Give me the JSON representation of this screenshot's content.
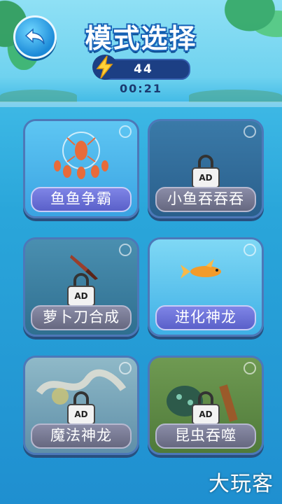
{
  "header": {
    "title": "模式选择",
    "energy_value": "44",
    "timer": "00:21"
  },
  "modes": [
    {
      "label": "鱼鱼争霸",
      "locked": false,
      "lock_text": ""
    },
    {
      "label": "小鱼吞吞吞",
      "locked": true,
      "lock_text": "AD"
    },
    {
      "label": "萝卜刀合成",
      "locked": true,
      "lock_text": "AD"
    },
    {
      "label": "进化神龙",
      "locked": false,
      "lock_text": ""
    },
    {
      "label": "魔法神龙",
      "locked": true,
      "lock_text": "AD"
    },
    {
      "label": "昆虫吞噬",
      "locked": true,
      "lock_text": "AD"
    }
  ],
  "watermark": "大玩客",
  "colors": {
    "label_active": "#6a70d8",
    "label_locked": "#7a7c96",
    "energy_bar": "#1c3f84",
    "accent_yellow": "#ffd23a"
  },
  "icons": {
    "back": "back-arrow-icon",
    "energy": "lightning-bolt-icon",
    "lock": "padlock-icon"
  }
}
